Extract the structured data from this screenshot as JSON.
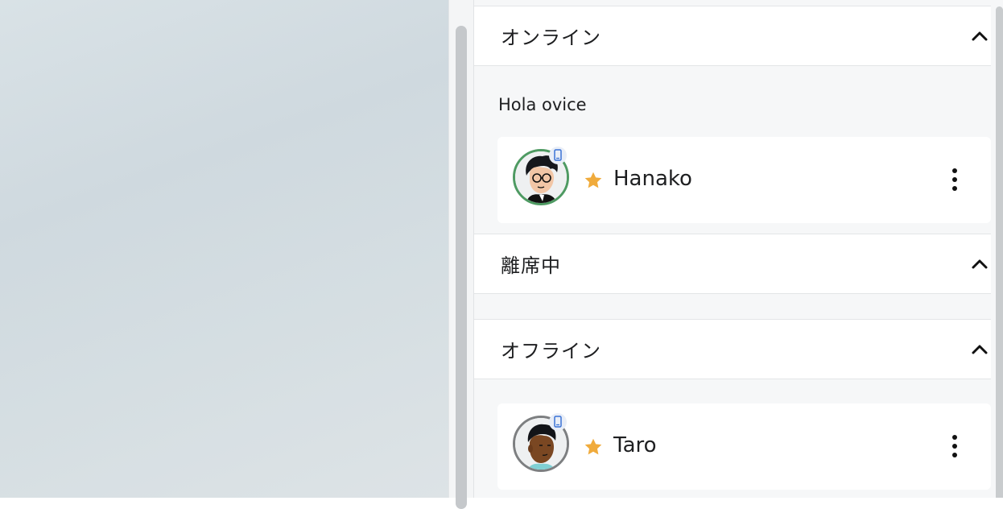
{
  "sections": {
    "online": {
      "title": "オンライン",
      "chevron_icon": "chevron-up-icon"
    },
    "away": {
      "title": "離席中",
      "chevron_icon": "chevron-up-icon"
    },
    "offline": {
      "title": "オフライン",
      "chevron_icon": "chevron-up-icon"
    }
  },
  "online_group": {
    "label": "Hola ovice"
  },
  "users": [
    {
      "name": "Hanako",
      "status": "online",
      "favorite": true,
      "device": "mobile-icon"
    },
    {
      "name": "Taro",
      "status": "offline",
      "favorite": true,
      "device": "mobile-icon"
    }
  ],
  "colors": {
    "online_ring": "#4e9a62",
    "offline_ring": "#7d7f81",
    "star": "#f0ab3c",
    "device_icon": "#3a72d6"
  }
}
